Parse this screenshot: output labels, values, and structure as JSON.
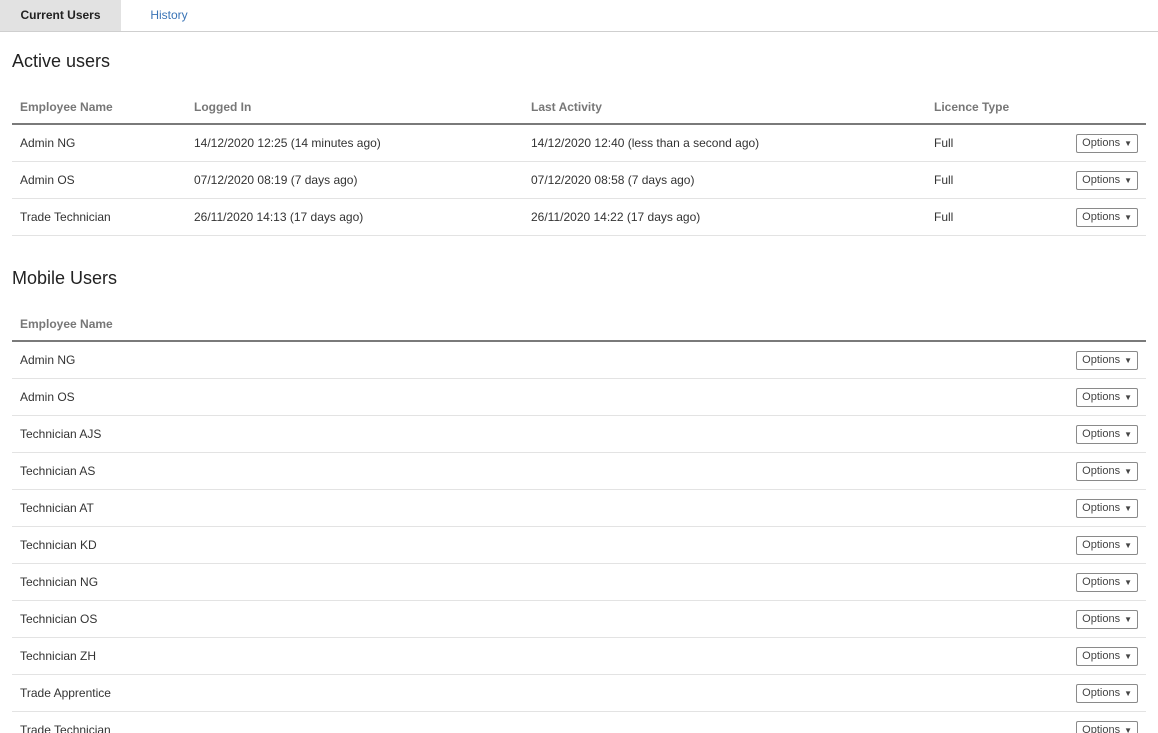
{
  "tabs": [
    {
      "label": "Current Users",
      "active": true
    },
    {
      "label": "History",
      "active": false
    }
  ],
  "active_users": {
    "title": "Active users",
    "columns": [
      "Employee Name",
      "Logged In",
      "Last Activity",
      "Licence Type"
    ],
    "rows": [
      {
        "name": "Admin NG",
        "logged_in": "14/12/2020 12:25 (14 minutes ago)",
        "last_activity": "14/12/2020 12:40 (less than a second ago)",
        "licence": "Full"
      },
      {
        "name": "Admin OS",
        "logged_in": "07/12/2020 08:19 (7 days ago)",
        "last_activity": "07/12/2020 08:58 (7 days ago)",
        "licence": "Full"
      },
      {
        "name": "Trade Technician",
        "logged_in": "26/11/2020 14:13 (17 days ago)",
        "last_activity": "26/11/2020 14:22 (17 days ago)",
        "licence": "Full"
      }
    ]
  },
  "mobile_users": {
    "title": "Mobile Users",
    "columns": [
      "Employee Name"
    ],
    "rows": [
      {
        "name": "Admin NG"
      },
      {
        "name": "Admin OS"
      },
      {
        "name": "Technician AJS"
      },
      {
        "name": "Technician AS"
      },
      {
        "name": "Technician AT"
      },
      {
        "name": "Technician KD"
      },
      {
        "name": "Technician NG"
      },
      {
        "name": "Technician OS"
      },
      {
        "name": "Technician ZH"
      },
      {
        "name": "Trade Apprentice"
      },
      {
        "name": "Trade Technician"
      }
    ]
  },
  "options_label": "Options",
  "icons": {
    "dropdown": "caret-down-icon"
  }
}
